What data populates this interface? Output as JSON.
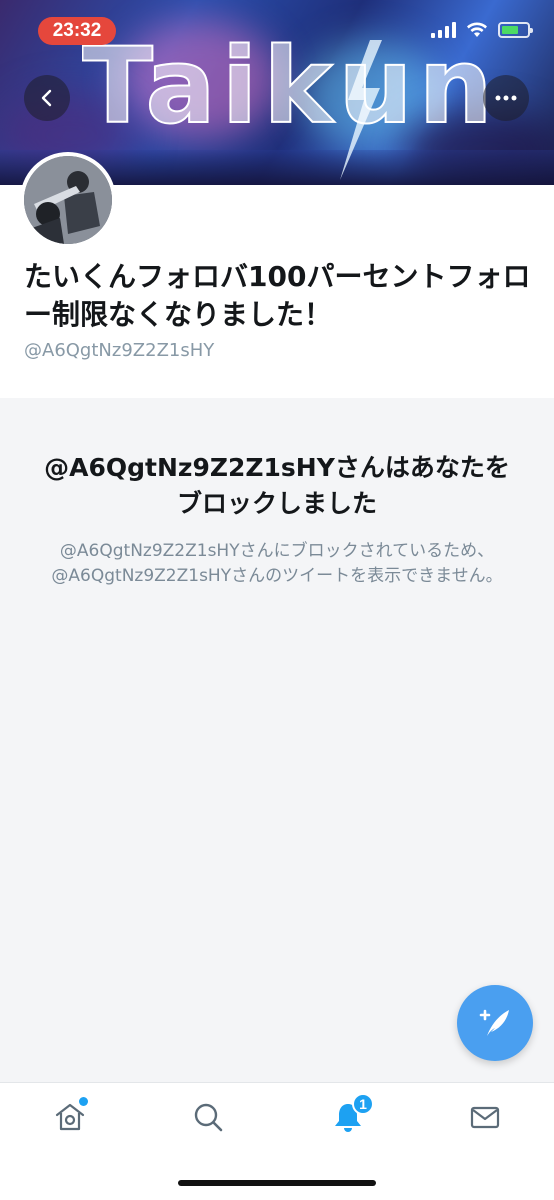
{
  "status_bar": {
    "time": "23:32",
    "battery_color": "#4cd964",
    "time_pill_color": "#e5473c"
  },
  "banner": {
    "word": "Taikun"
  },
  "header": {
    "back_icon": "chevron-left-icon",
    "more_icon": "more-horizontal-icon"
  },
  "profile": {
    "display_name": "たいくんフォロバ100パーセントフォロー制限なくなりました！",
    "handle": "@A6QgtNz9Z2Z1sHY"
  },
  "blocked": {
    "title": "@A6QgtNz9Z2Z1sHYさんはあなたをブロックしました",
    "description": "@A6QgtNz9Z2Z1sHYさんにブロックされているため、@A6QgtNz9Z2Z1sHYさんのツイートを表示できません。"
  },
  "fab": {
    "icon": "compose-tweet-icon",
    "color": "#4a9ff0"
  },
  "tabbar": {
    "tabs": [
      {
        "name": "home",
        "icon": "home-icon"
      },
      {
        "name": "search",
        "icon": "search-icon"
      },
      {
        "name": "notifications",
        "icon": "bell-icon",
        "badge": "1"
      },
      {
        "name": "messages",
        "icon": "mail-icon"
      }
    ],
    "accent": "#1da1f2"
  }
}
